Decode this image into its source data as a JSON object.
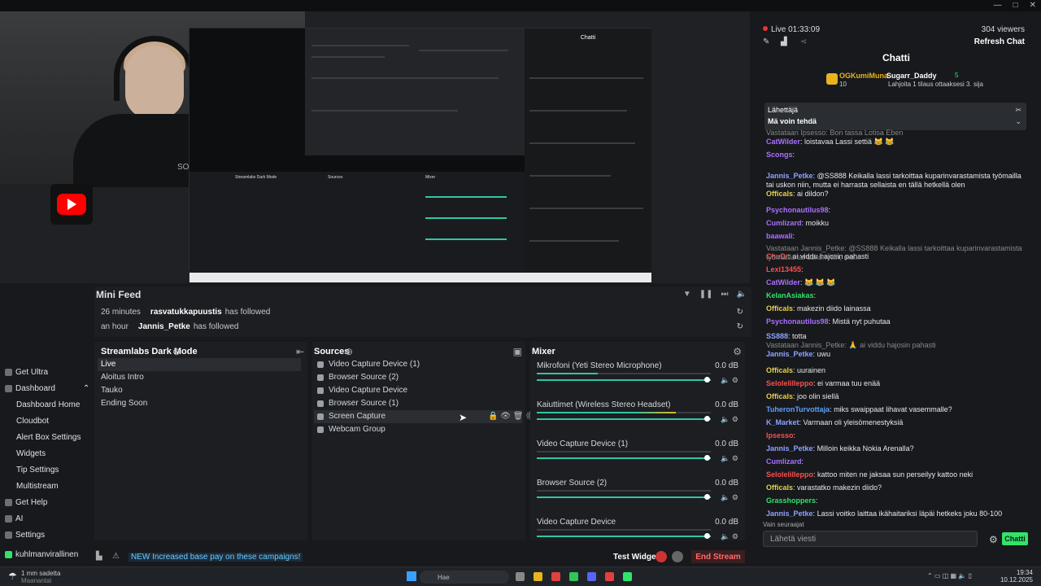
{
  "window": {
    "controls": [
      "—",
      "□",
      "✕"
    ]
  },
  "preview": {
    "webcam_brand": "SOHO",
    "screenshot_panels": {
      "chat_title": "Chatti",
      "scenes_title": "Streamlabs Dark Mode",
      "sources_title": "Sources",
      "mixer_title": "Mixer"
    }
  },
  "mini_feed": {
    "title": "Mini Feed",
    "events": [
      {
        "time": "26 minutes",
        "user": "rasvatukkapuustis",
        "action": "has followed"
      },
      {
        "time": "an hour",
        "user": "Jannis_Petke",
        "action": "has followed"
      }
    ]
  },
  "left_nav": [
    {
      "label": "Get Ultra",
      "sub": false
    },
    {
      "label": "Dashboard",
      "sub": false
    },
    {
      "label": "Dashboard Home",
      "sub": true
    },
    {
      "label": "Cloudbot",
      "sub": true
    },
    {
      "label": "Alert Box Settings",
      "sub": true
    },
    {
      "label": "Widgets",
      "sub": true
    },
    {
      "label": "Tip Settings",
      "sub": true
    },
    {
      "label": "Multistream",
      "sub": true
    },
    {
      "label": "Get Help",
      "sub": false
    },
    {
      "label": "AI",
      "sub": false
    },
    {
      "label": "Settings",
      "sub": false
    },
    {
      "label": "kuhlmanvirallinen",
      "sub": false
    }
  ],
  "scenes": {
    "title": "Streamlabs Dark Mode",
    "items": [
      "Live",
      "Aloitus Intro",
      "Tauko",
      "Ending Soon"
    ],
    "active": "Live"
  },
  "sources": {
    "title": "Sources",
    "items": [
      "Video Capture Device (1)",
      "Browser Source (2)",
      "Video Capture Device",
      "Browser Source (1)",
      "Screen Capture",
      "Webcam Group"
    ]
  },
  "mixer": {
    "title": "Mixer",
    "channels": [
      {
        "name": "Mikrofoni (Yeti Stereo Microphone)",
        "db": "0.0 dB",
        "level": 0.35
      },
      {
        "name": "Kaiuttimet (Wireless Stereo Headset)",
        "db": "0.0 dB",
        "level": 0.8
      },
      {
        "name": "Video Capture Device (1)",
        "db": "0.0 dB",
        "level": 0
      },
      {
        "name": "Browser Source (2)",
        "db": "0.0 dB",
        "level": 0
      },
      {
        "name": "Video Capture Device",
        "db": "0.0 dB",
        "level": 0
      }
    ]
  },
  "bottom_bar": {
    "news": "NEW Increased base pay on these campaigns!",
    "test_widgets": "Test Widgets",
    "end_stream": "End Stream"
  },
  "chat": {
    "live": "Live 01:33:09",
    "viewers": "304 viewers",
    "refresh": "Refresh Chat",
    "title": "Chatti",
    "top_gifter": "OGKumiMuna",
    "top_gifter_count": "10",
    "sub_gifter": "Sugarr_Daddy",
    "sub_gifter_count": "5",
    "sub_gifter_text": "Lahjoita 1 tilaus ottaaksesi 3. sija",
    "pinned_by": "Lähettäjä",
    "pinned_text": "Mä voin tehdä",
    "messages": [
      {
        "user": "CatWilder",
        "text": "loistavaa Lassi settiä 😹 😹",
        "color": "#a970ff"
      },
      {
        "user": "Scongs",
        "text": "",
        "color": "#a970ff"
      },
      {
        "user": "Jannis_Petke",
        "text": "@SS888 Keikalla lassi tarkoittaa kuparinvarastamista työmailla tai uskon niin, mutta ei harrasta sellaista en tällä hetkellä olen",
        "color": "#8fa3ff"
      },
      {
        "user": "Officals",
        "text": "ai dildon?",
        "color": "#e6d24a"
      },
      {
        "user": "Psychonautilus98",
        "text": "",
        "color": "#a970ff"
      },
      {
        "user": "Cumlizard",
        "text": "moikku",
        "color": "#a970ff"
      },
      {
        "user": "baawali",
        "text": "",
        "color": "#a970ff"
      },
      {
        "user": "ChuDr",
        "text": "ai viddu hajosin pahasti",
        "color": "#ff4d4d"
      },
      {
        "user": "Lexi13455",
        "text": "",
        "color": "#ff4d4d"
      },
      {
        "user": "CatWilder",
        "text": "😹 😹 😹",
        "color": "#a970ff"
      },
      {
        "user": "KelanAsiakas",
        "text": "",
        "color": "#31e36a"
      },
      {
        "user": "Officals",
        "text": "makezin diido lainassa",
        "color": "#e6d24a"
      },
      {
        "user": "Psychonautilus98",
        "text": "Mistä nyt puhutaa",
        "color": "#a970ff"
      },
      {
        "user": "SS888",
        "text": "totta",
        "color": "#8fa3ff"
      },
      {
        "user": "Jannis_Petke",
        "text": "uwu",
        "color": "#8fa3ff"
      },
      {
        "user": "Officals",
        "text": "uurainen",
        "color": "#e6d24a"
      },
      {
        "user": "Selolelilleppo",
        "text": "ei varmaa tuu enää",
        "color": "#ff4d4d"
      },
      {
        "user": "Officals",
        "text": "joo olin siellä",
        "color": "#e6d24a"
      },
      {
        "user": "TuheronTurvottaja",
        "text": "miks swaippaat lihavat vasemmalle?",
        "color": "#5aa0ff"
      },
      {
        "user": "K_Market",
        "text": "Varmaan oli yleisömenestyksiä",
        "color": "#8fa3ff"
      },
      {
        "user": "Ipsesso",
        "text": "",
        "color": "#ff4d4d"
      },
      {
        "user": "Jannis_Petke",
        "text": "Milloin keikka Nokia Arenalla?",
        "color": "#8fa3ff"
      },
      {
        "user": "Cumlizard",
        "text": "",
        "color": "#a970ff"
      },
      {
        "user": "Selolelilleppo",
        "text": "kattoo miten ne jaksaa sun perseilyy kattoo neki",
        "color": "#ff4d4d"
      },
      {
        "user": "Officals",
        "text": "varastatko makezin diido?",
        "color": "#e6d24a"
      },
      {
        "user": "Grasshoppers",
        "text": "",
        "color": "#31e36a"
      },
      {
        "user": "Jannis_Petke",
        "text": "Lassi voitko laittaa ikähaitariksi läpäi hetkeks joku 80-100",
        "color": "#8fa3ff"
      }
    ],
    "reply_1": "Vastataan Ipsesso: Bon tassa Lotisa Eben",
    "reply_2": "Vastataan Jannis_Petke: @SS888 Keikalla lassi tarkoittaa kuparinvarastamista työmailla tai uskon niin, mu...",
    "reply_3": "Vastataan Jannis_Petke: 🙏 ai viddu hajosin pahasti",
    "followers_only": "Vain seuraajat",
    "input_placeholder": "Lähetä viesti",
    "send": "Chatti"
  },
  "taskbar": {
    "weather": "1 mm sadetta",
    "weather_sub": "Maanantai",
    "search": "Hae",
    "time": "19:34",
    "date": "10.12.2025"
  },
  "colors": {
    "accent": "#31e36a",
    "teal": "#31c4a6",
    "danger": "#ff6b6b"
  }
}
